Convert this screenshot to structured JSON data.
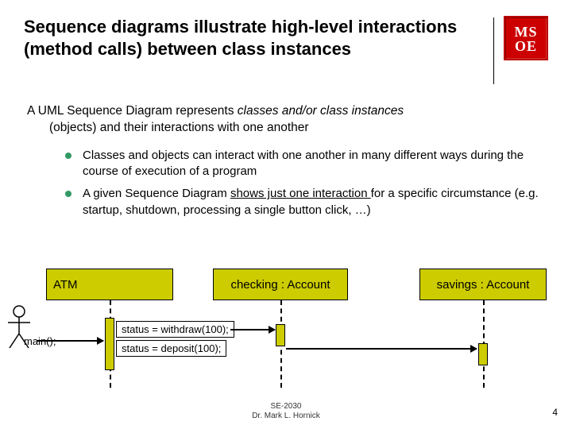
{
  "title": "Sequence diagrams illustrate high-level interactions (method calls) between class instances",
  "logo": {
    "row1": "MS",
    "row2": "OE"
  },
  "intro": {
    "pre": "A UML Sequence Diagram represents ",
    "em": "classes and/or class instances",
    "post_line1": "(objects) and their interactions with one another"
  },
  "bullets": [
    "Classes and objects can interact with one another in many different ways during the course of execution of a program",
    {
      "pre": "A given Sequence Diagram ",
      "underlined": "shows just one interaction ",
      "post": "for a specific circumstance (e.g. startup, shutdown, processing a single button click, …)"
    }
  ],
  "diagram": {
    "objects": [
      "ATM",
      "checking : Account",
      "savings : Account"
    ],
    "actor_label": "main();",
    "messages": [
      "status = withdraw(100);",
      "status = deposit(100);"
    ]
  },
  "footer": {
    "line1": "SE-2030",
    "line2": "Dr. Mark L. Hornick"
  },
  "page": "4"
}
